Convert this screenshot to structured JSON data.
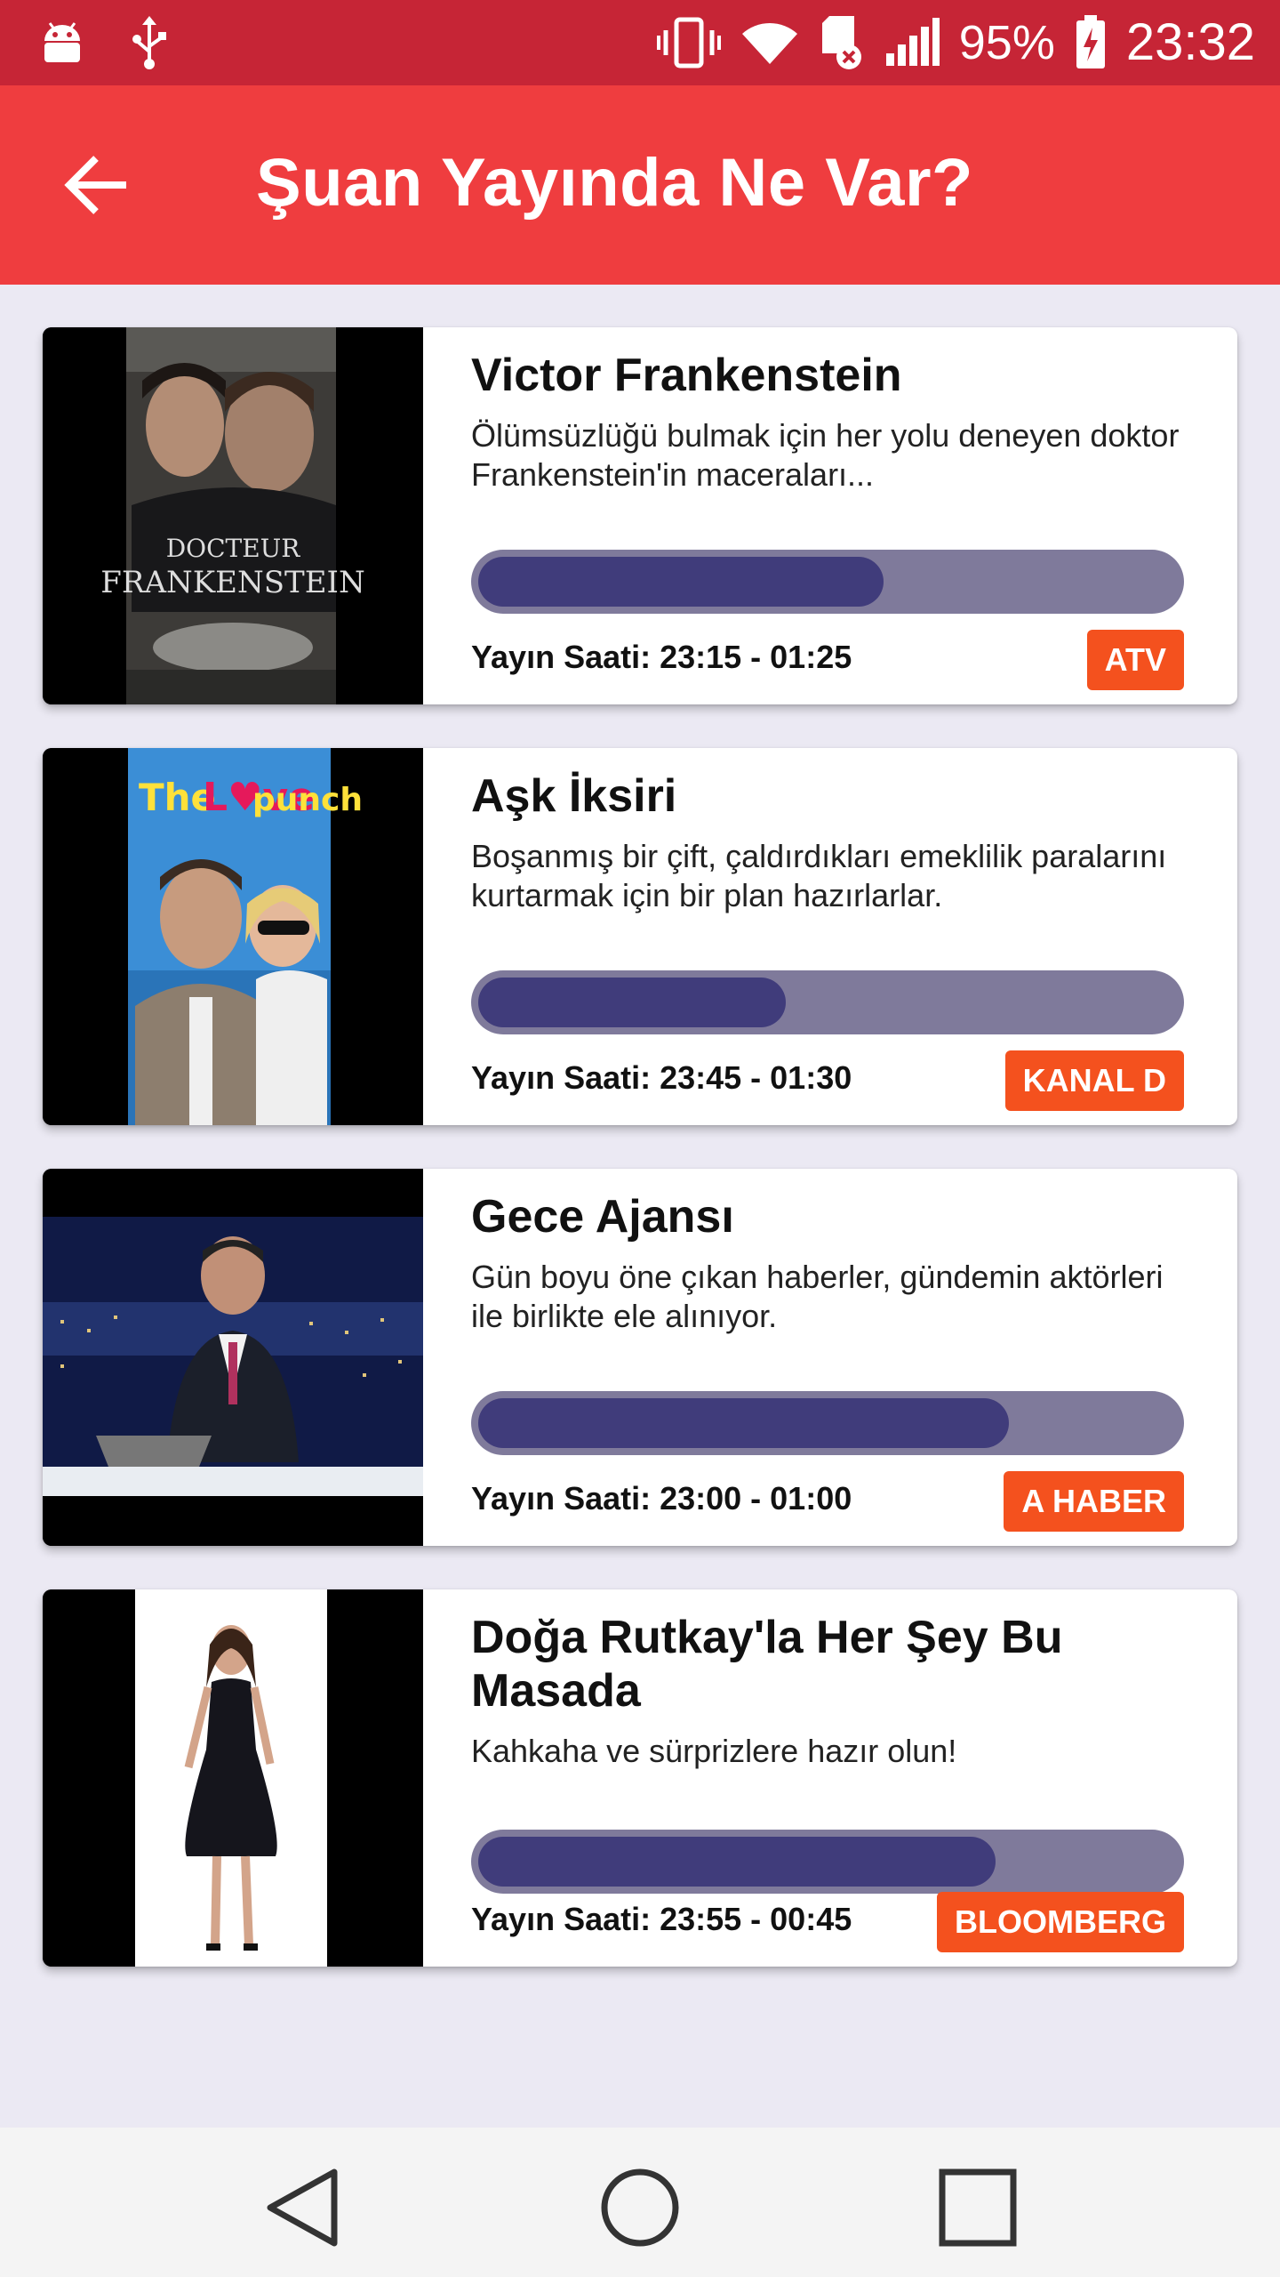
{
  "status_bar": {
    "battery_percent": "95%",
    "time": "23:32",
    "icons": [
      "android-icon",
      "usb-icon",
      "vibrate-icon",
      "wifi-icon",
      "sd-card-icon",
      "signal-icon",
      "battery-charging-icon"
    ]
  },
  "app_bar": {
    "title": "Şuan Yayında Ne Var?",
    "back_icon": "arrow-back-icon"
  },
  "programs": [
    {
      "title": "Victor Frankenstein",
      "description": "Ölümsüzlüğü bulmak için her yolu deneyen doktor Frankenstein'in maceraları...",
      "progress": 0.58,
      "time": "Yayın Saati: 23:15 - 01:25",
      "channel": "ATV",
      "image": "Victor Frankenstein movie poster"
    },
    {
      "title": "Aşk İksiri",
      "description": "Boşanmış bir çift, çaldırdıkları emeklilik paralarını kurtarmak için bir plan hazırlarlar.",
      "progress": 0.44,
      "time": "Yayın Saati: 23:45 - 01:30",
      "channel": "KANAL D",
      "image": "The Love Punch movie poster"
    },
    {
      "title": "Gece Ajansı",
      "description": "Gün boyu öne çıkan haberler, gündemin aktörleri ile birlikte ele alınıyor.",
      "progress": 0.76,
      "time": "Yayın Saati: 23:00 - 01:00",
      "channel": "A HABER",
      "image": "news anchor at desk with city skyline"
    },
    {
      "title": "Doğa Rutkay'la Her Şey Bu Masada",
      "description": "Kahkaha ve sürprizlere hazır olun!",
      "progress": 0.74,
      "time": "Yayın Saati: 23:55 - 00:45",
      "channel": "BLOOMBERG",
      "image": "woman in black dress"
    }
  ],
  "nav_bar": [
    "back-triangle-icon",
    "home-circle-icon",
    "recents-square-icon"
  ],
  "colors": {
    "status_bar": "#c62536",
    "app_bar": "#ef3d3f",
    "background": "#ebe9f3",
    "progress_track": "#7f7a9b",
    "progress_fill": "#403c7b",
    "channel_badge": "#f4511e"
  }
}
